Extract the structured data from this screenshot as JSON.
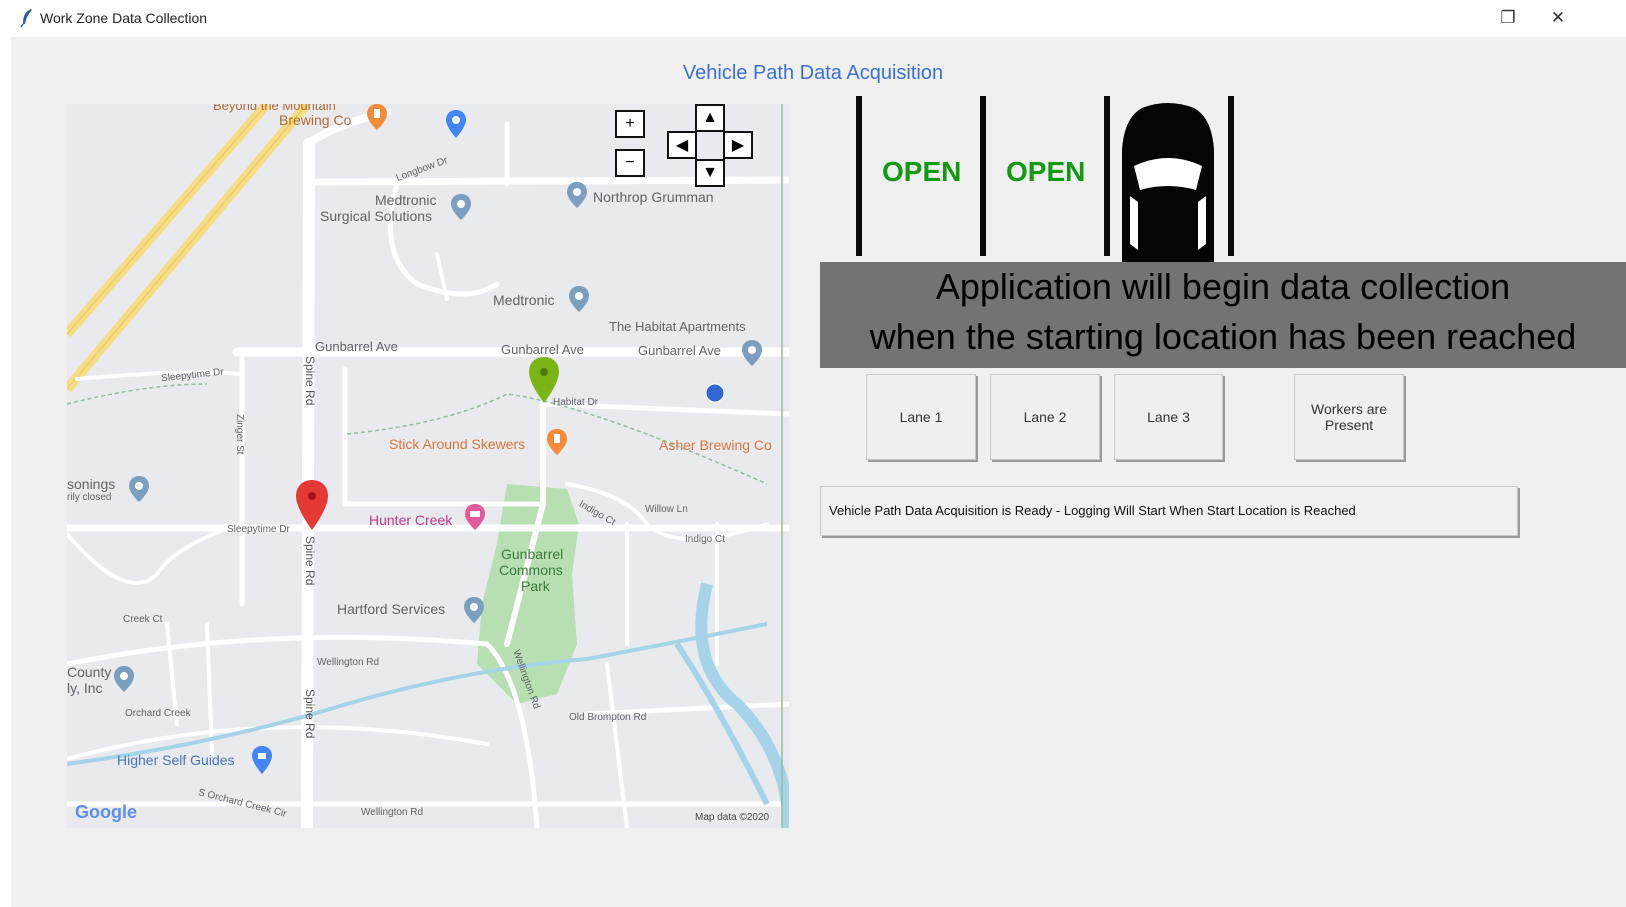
{
  "window": {
    "title": "Work Zone Data Collection",
    "maximize_glyph": "❐",
    "close_glyph": "✕"
  },
  "heading": "Vehicle Path Data Acquisition",
  "map": {
    "labels": {
      "beyond": "Beyond the Mountain",
      "brewing": "Brewing Co",
      "longbow": "Longbow Dr",
      "medtronic_surgical_1": "Medtronic",
      "medtronic_surgical_2": "Surgical Solutions",
      "northrop": "Northrop Grumman",
      "medtronic": "Medtronic",
      "habitat_apts": "The Habitat Apartments",
      "gunbarrel_1": "Gunbarrel Ave",
      "gunbarrel_2": "Gunbarrel Ave",
      "gunbarrel_3": "Gunbarrel Ave",
      "sleepytime_1": "Sleepytime Dr",
      "spine_1": "Spine Rd",
      "zinger": "Zinger St",
      "habitat_dr": "Habitat Dr",
      "stick_around": "Stick Around Skewers",
      "asher": "Asher Brewing Co",
      "masonings": "sonings",
      "masonings_sub": "rily closed",
      "willow": "Willow Ln",
      "indigo_1": "Indigo Ct",
      "indigo_2": "Indigo Ct",
      "hunter_creek": "Hunter Creek",
      "sleepytime_2": "Sleepytime Dr",
      "spine_2": "Spine Rd",
      "gunbarrel_park_1": "Gunbarrel",
      "gunbarrel_park_2": "Commons",
      "gunbarrel_park_3": "Park",
      "hartford": "Hartford Services",
      "creek_ct": "Creek Ct",
      "wellington_1": "Wellington Rd",
      "county_1": "County",
      "county_2": "ly, Inc",
      "orchard_creek": "Orchard Creek",
      "spine_3": "Spine Rd",
      "old_brompton": "Old Brompton Rd",
      "wellington_2": "Wellington Rd",
      "higher_self": "Higher Self Guides",
      "orchard_creek_cir": "S Orchard Creek Cir",
      "wellington_3": "Wellington Rd",
      "google": "Google",
      "map_data": "Map data ©2020"
    },
    "controls": {
      "zoom_in": "+",
      "zoom_out": "−",
      "pan_up": "▲",
      "pan_left": "◀",
      "pan_right": "▶",
      "pan_down": "▼"
    }
  },
  "lanes_display": {
    "lane1_status": "OPEN",
    "lane2_status": "OPEN",
    "lane3_status": "occupied (car icon)"
  },
  "banner": {
    "line1": "Application will begin data collection",
    "line2": "when the starting location has been reached"
  },
  "buttons": {
    "lane1": "Lane 1",
    "lane2": "Lane 2",
    "lane3": "Lane 3",
    "workers_1": "Workers are",
    "workers_2": "Present"
  },
  "status_text": "Vehicle Path Data Acquisition is Ready - Logging Will Start When Start Location is Reached",
  "colors": {
    "heading": "#3a6fd8",
    "open": "#129a12",
    "banner": "#737373",
    "map_bg": "#e8eaed",
    "park": "#b7dfb1",
    "water": "#a5d4e8",
    "highway": "#f6dd85"
  }
}
